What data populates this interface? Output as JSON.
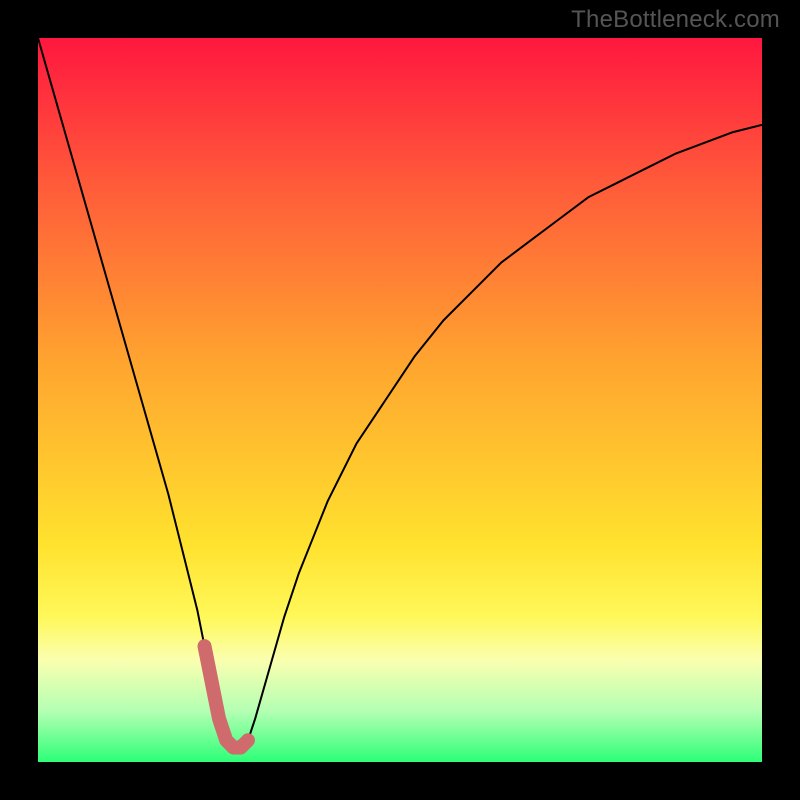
{
  "watermark": "TheBottleneck.com",
  "colors": {
    "frame": "#000000",
    "curve": "#000000",
    "highlight": "#cf6a6d",
    "gradient_stops": [
      {
        "y": 0.0,
        "color": "#ff173f"
      },
      {
        "y": 0.2,
        "color": "#ff5a3a"
      },
      {
        "y": 0.45,
        "color": "#ffa52f"
      },
      {
        "y": 0.7,
        "color": "#ffe22e"
      },
      {
        "y": 0.8,
        "color": "#fff85a"
      },
      {
        "y": 0.86,
        "color": "#faffb0"
      },
      {
        "y": 0.93,
        "color": "#b3ffb3"
      },
      {
        "y": 1.0,
        "color": "#2dff77"
      }
    ]
  },
  "chart_data": {
    "type": "line",
    "title": "",
    "xlabel": "",
    "ylabel": "",
    "xlim": [
      0,
      100
    ],
    "ylim": [
      0,
      100
    ],
    "grid": false,
    "x": [
      0,
      2,
      4,
      6,
      8,
      10,
      12,
      14,
      16,
      18,
      20,
      22,
      23,
      24,
      25,
      26,
      27,
      28,
      29,
      30,
      32,
      34,
      36,
      38,
      40,
      44,
      48,
      52,
      56,
      60,
      64,
      68,
      72,
      76,
      80,
      84,
      88,
      92,
      96,
      100
    ],
    "values": [
      100,
      93,
      86,
      79,
      72,
      65,
      58,
      51,
      44,
      37,
      29,
      21,
      16,
      11,
      6,
      3,
      2,
      2,
      3,
      6,
      13,
      20,
      26,
      31,
      36,
      44,
      50,
      56,
      61,
      65,
      69,
      72,
      75,
      78,
      80,
      82,
      84,
      85.5,
      87,
      88
    ],
    "highlight_range": [
      23,
      29
    ],
    "legend": []
  }
}
